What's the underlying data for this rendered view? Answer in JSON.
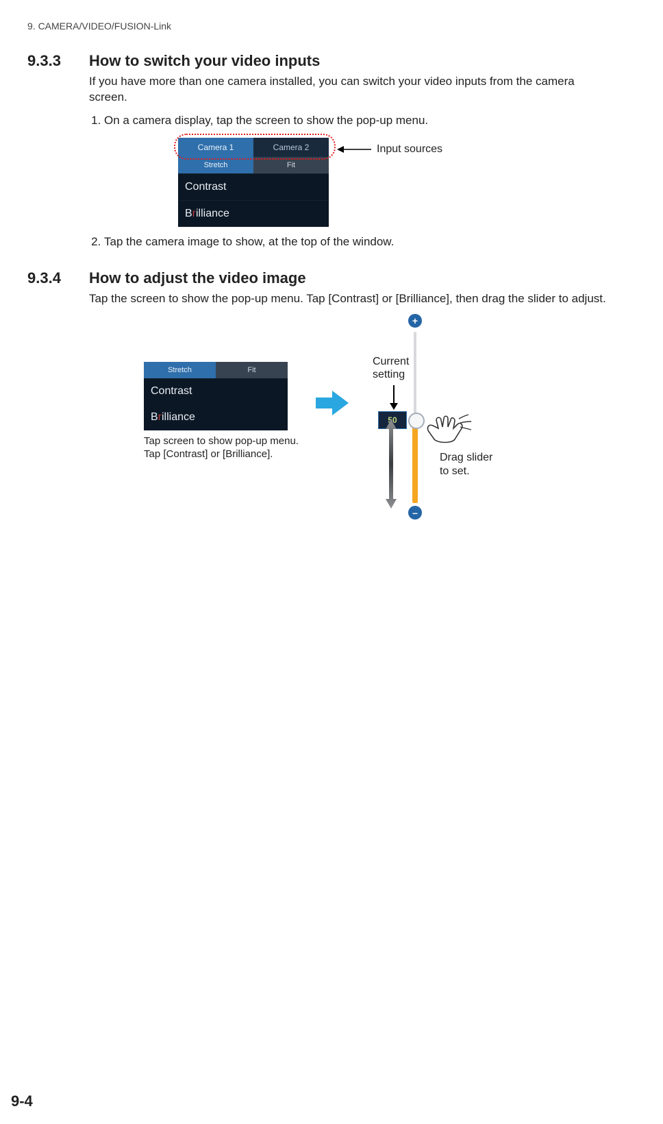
{
  "running_header": "9.  CAMERA/VIDEO/FUSION-Link",
  "s933": {
    "number": "9.3.3",
    "title": "How to switch your video inputs",
    "intro": "If you have more than one camera installed, you can switch your video inputs from the camera screen.",
    "step1": "On a camera display, tap the screen to show the pop-up menu.",
    "step2": "Tap the camera image to show, at the top of the window.",
    "input_sources_label": "Input sources",
    "popup": {
      "camera1": "Camera 1",
      "camera2": "Camera 2",
      "stretch": "Stretch",
      "fit": "Fit",
      "contrast": "Contrast",
      "brilliance_prefix": "B",
      "brilliance_highlight": "r",
      "brilliance_rest": "illiance"
    }
  },
  "s934": {
    "number": "9.3.4",
    "title": "How to adjust the video image",
    "intro": "Tap the screen to show the pop-up menu. Tap [Contrast] or [Brilliance], then drag the slider to adjust.",
    "caption_line1": "Tap screen to show pop-up menu.",
    "caption_line2": "Tap [Contrast] or [Brilliance].",
    "current_setting_label1": "Current",
    "current_setting_label2": "setting",
    "slider_value": "50",
    "drag_line1": "Drag slider",
    "drag_line2": "to set.",
    "popup": {
      "stretch": "Stretch",
      "fit": "Fit",
      "contrast": "Contrast",
      "brilliance_prefix": "B",
      "brilliance_highlight": "r",
      "brilliance_rest": "illiance"
    }
  },
  "page_number": "9-4"
}
